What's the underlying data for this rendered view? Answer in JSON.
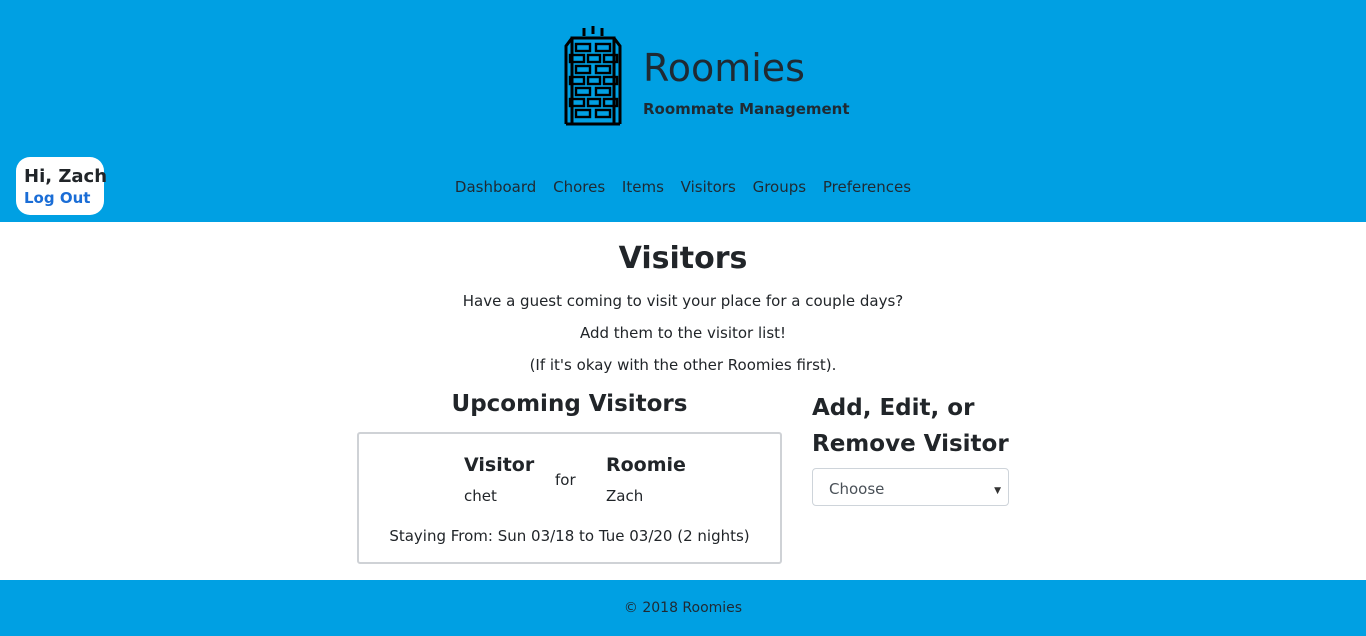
{
  "brand": {
    "title": "Roomies",
    "subtitle": "Roommate Management"
  },
  "user": {
    "greeting": "Hi, Zach",
    "logout_label": "Log Out"
  },
  "nav": {
    "items": [
      {
        "label": "Dashboard"
      },
      {
        "label": "Chores"
      },
      {
        "label": "Items"
      },
      {
        "label": "Visitors"
      },
      {
        "label": "Groups"
      },
      {
        "label": "Preferences"
      }
    ]
  },
  "page": {
    "title": "Visitors",
    "intro": [
      "Have a guest coming to visit your place for a couple days?",
      "Add them to the visitor list!",
      "(If it's okay with the other Roomies first)."
    ]
  },
  "upcoming": {
    "title": "Upcoming Visitors",
    "visitor_header": "Visitor",
    "for_label": "for",
    "roomie_header": "Roomie",
    "entries": [
      {
        "visitor": "chet",
        "roomie": "Zach",
        "stay": "Staying From: Sun 03/18 to Tue 03/20 (2 nights)"
      }
    ]
  },
  "edit": {
    "title": "Add, Edit, or Remove Visitor",
    "select_value": "Choose"
  },
  "footer": {
    "text": "© 2018 Roomies"
  },
  "colors": {
    "header_bg": "#00a0e3",
    "link": "#1a6dd6",
    "text": "#212529"
  },
  "icons": {
    "logo": "building-icon",
    "dropdown": "caret-down-icon"
  }
}
